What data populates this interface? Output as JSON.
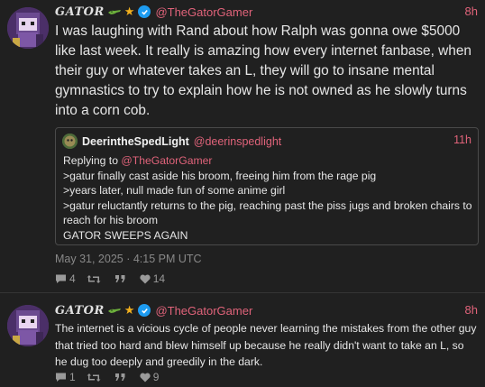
{
  "posts": [
    {
      "display_name": "GATOR",
      "handle": "@TheGatorGamer",
      "time": "8h",
      "text": "I was laughing with Rand about how Ralph was gonna owe $5000 like last week. It really is amazing how every internet fanbase, when their guy or whatever takes an L, they will go to insane mental gymnastics to try to explain how he is not owned as he slowly turns into a corn cob.",
      "quote": {
        "display_name": "DeerintheSpedLight",
        "handle": "@deerinspedlight",
        "time": "11h",
        "reply_prefix": "Replying to",
        "reply_handle": "@TheGatorGamer",
        "lines": [
          ">gatur finally cast aside his broom, freeing him from the rage pig",
          ">years later, null made fun of some anime girl",
          ">gatur reluctantly returns to the pig, reaching past the piss jugs and broken chairs to reach for his broom",
          "GATOR SWEEPS AGAIN"
        ]
      },
      "date": "May 31, 2025 · 4:15 PM UTC",
      "actions": {
        "replies": "4",
        "reposts": "",
        "quotes": "",
        "likes": "14"
      }
    },
    {
      "display_name": "GATOR",
      "handle": "@TheGatorGamer",
      "time": "8h",
      "text": "The internet is a vicious cycle of people never learning the mistakes from the other guy that tried too hard and blew himself up because he really didn't want to take an L, so he dug too deeply and greedily in the dark.",
      "actions": {
        "replies": "1",
        "reposts": "",
        "quotes": "",
        "likes": "9"
      }
    }
  ],
  "colors": {
    "background": "#202020",
    "handle": "#e0637a",
    "star": "#f2b01e",
    "verified": "#1d9bf0",
    "muted": "#888888"
  },
  "icons": {
    "reply": "comment-icon",
    "repost": "retweet-icon",
    "quote": "quote-icon",
    "like": "heart-icon",
    "badge_emoji": "crocodile-icon",
    "badge_star": "star-icon",
    "verified": "verified-check-icon"
  }
}
